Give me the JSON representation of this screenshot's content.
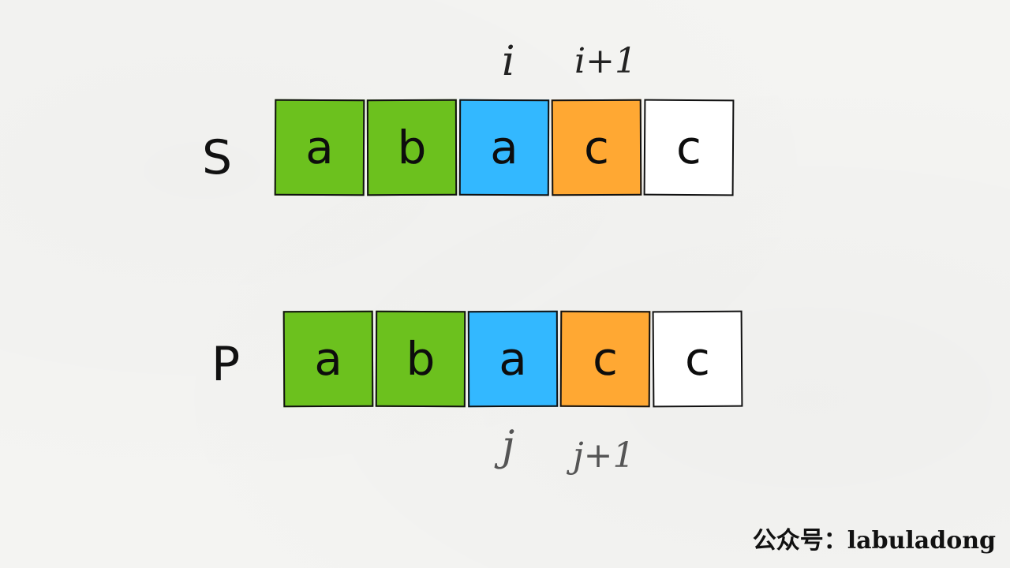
{
  "rows": [
    {
      "label": "S",
      "cells": [
        {
          "char": "a",
          "color": "#6cc11e"
        },
        {
          "char": "b",
          "color": "#6cc11e"
        },
        {
          "char": "a",
          "color": "#33b8ff"
        },
        {
          "char": "c",
          "color": "#ffa833"
        },
        {
          "char": "c",
          "color": "#ffffff"
        }
      ]
    },
    {
      "label": "P",
      "cells": [
        {
          "char": "a",
          "color": "#6cc11e"
        },
        {
          "char": "b",
          "color": "#6cc11e"
        },
        {
          "char": "a",
          "color": "#33b8ff"
        },
        {
          "char": "c",
          "color": "#ffa833"
        },
        {
          "char": "c",
          "color": "#ffffff"
        }
      ]
    }
  ],
  "pointers": {
    "s_i": "i",
    "s_i1": "i+1",
    "p_j": "j",
    "p_j1": "j+1"
  },
  "watermark": "公众号：labuladong"
}
